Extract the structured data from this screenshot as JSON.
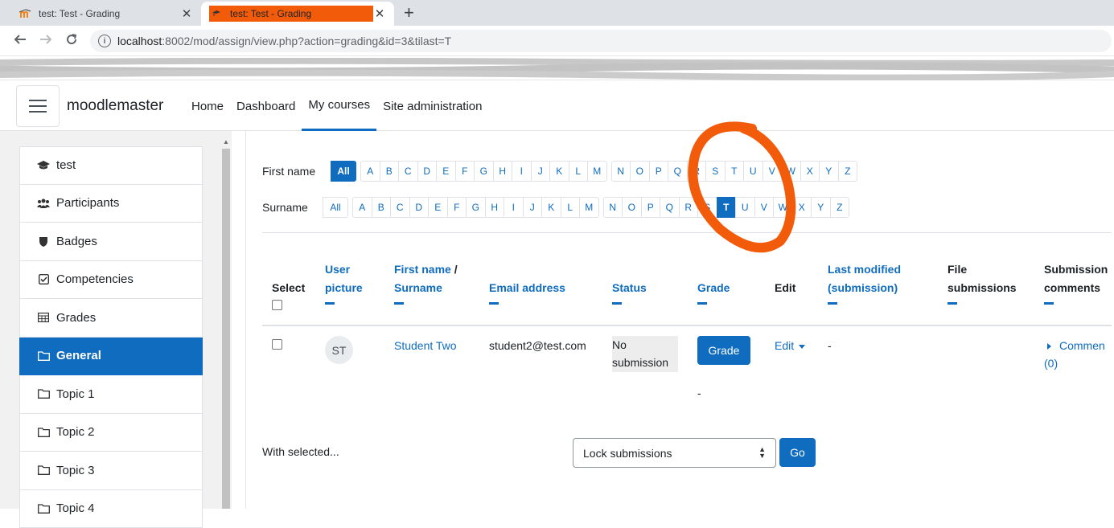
{
  "browser": {
    "tabs": [
      {
        "title": "test: Test - Grading",
        "favicon": "moodle-favicon",
        "active": false
      },
      {
        "title": "test: Test - Grading",
        "favicon": "moodle-favicon",
        "active": true
      }
    ],
    "new_tab_symbol": "+",
    "url_host": "localhost",
    "url_path": ":8002/mod/assign/view.php?action=grading&id=3&tilast=T"
  },
  "navbar": {
    "brand": "moodlemaster",
    "links": [
      "Home",
      "Dashboard",
      "My courses",
      "Site administration"
    ],
    "active_link": "My courses"
  },
  "drawer": {
    "items": [
      {
        "label": "test",
        "icon": "graduation-cap-icon",
        "active": false
      },
      {
        "label": "Participants",
        "icon": "users-icon",
        "active": false
      },
      {
        "label": "Badges",
        "icon": "shield-icon",
        "active": false
      },
      {
        "label": "Competencies",
        "icon": "check-square-icon",
        "active": false
      },
      {
        "label": "Grades",
        "icon": "table-icon",
        "active": false
      },
      {
        "label": "General",
        "icon": "folder-icon",
        "active": true
      },
      {
        "label": "Topic 1",
        "icon": "folder-icon",
        "active": false
      },
      {
        "label": "Topic 2",
        "icon": "folder-icon",
        "active": false
      },
      {
        "label": "Topic 3",
        "icon": "folder-icon",
        "active": false
      },
      {
        "label": "Topic 4",
        "icon": "folder-icon",
        "active": false
      }
    ]
  },
  "initials": {
    "firstname_label": "First name",
    "surname_label": "Surname",
    "all_label": "All",
    "letters": [
      "A",
      "B",
      "C",
      "D",
      "E",
      "F",
      "G",
      "H",
      "I",
      "J",
      "K",
      "L",
      "M",
      "N",
      "O",
      "P",
      "Q",
      "R",
      "S",
      "T",
      "U",
      "V",
      "W",
      "X",
      "Y",
      "Z"
    ],
    "firstname_selected": "All",
    "surname_selected": "T"
  },
  "table": {
    "headers": {
      "select": "Select",
      "user_picture": [
        "User",
        "picture"
      ],
      "firstname": "First name",
      "separator": " /",
      "surname": "Surname",
      "email": "Email address",
      "status": "Status",
      "grade": "Grade",
      "edit": "Edit",
      "last_modified": [
        "Last modified",
        "(submission)"
      ],
      "file_submissions": [
        "File",
        "submissions"
      ],
      "submission_comments": [
        "Submission",
        "comments"
      ]
    },
    "rows": [
      {
        "initials": "ST",
        "fullname": "Student Two",
        "email": "student2@test.com",
        "status": [
          "No",
          "submission"
        ],
        "grade_button": "Grade",
        "grade_value": "-",
        "edit_label": "Edit",
        "last_modified": "-",
        "comments_label": "Commen",
        "comments_count": "(0)"
      }
    ]
  },
  "bulk": {
    "with_selected": "With selected...",
    "action_selected": "Lock submissions",
    "go_label": "Go"
  },
  "colors": {
    "primary": "#0f6cbf",
    "annotation": "#f25b0a",
    "drawer_bg": "#f1f1f1"
  }
}
